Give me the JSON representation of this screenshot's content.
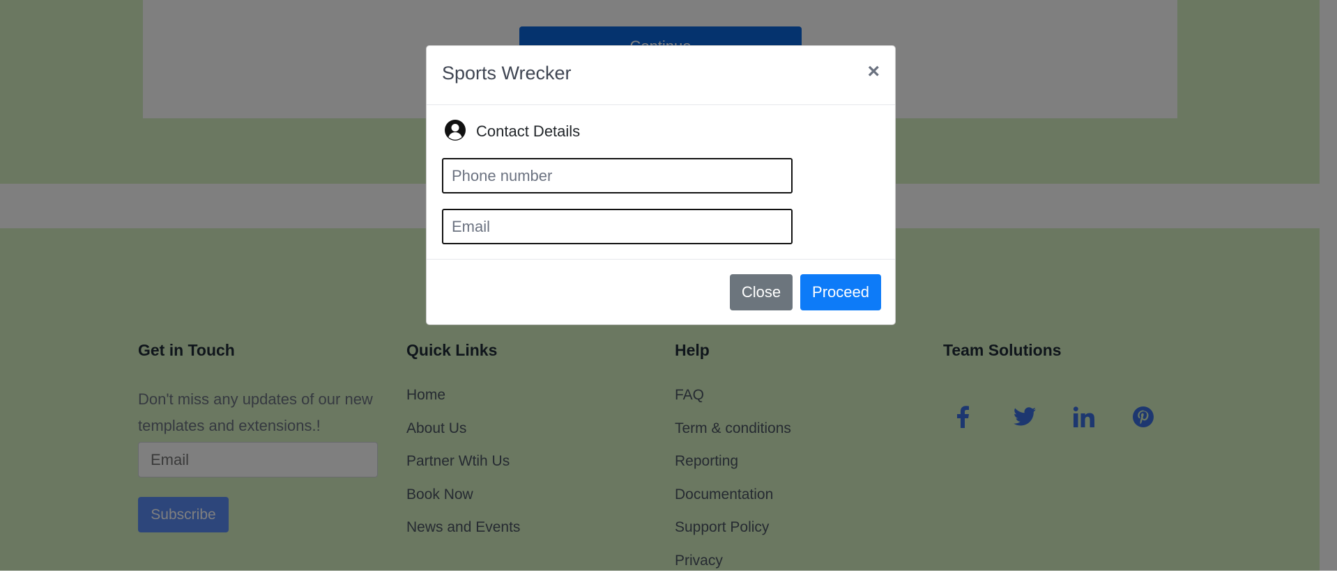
{
  "background": {
    "continue_button_label": "Continue"
  },
  "footer": {
    "get_in_touch": {
      "heading": "Get in Touch",
      "description": "Don't miss any updates of our new templates and extensions.!",
      "email_placeholder": "Email",
      "subscribe_label": "Subscribe"
    },
    "quick_links": {
      "heading": "Quick Links",
      "items": [
        "Home",
        "About Us",
        "Partner Wtih Us",
        "Book Now",
        "News and Events"
      ]
    },
    "help": {
      "heading": "Help",
      "items": [
        "FAQ",
        "Term & conditions",
        "Reporting",
        "Documentation",
        "Support Policy",
        "Privacy"
      ]
    },
    "team_solutions": {
      "heading": "Team Solutions",
      "social_icons": [
        "facebook-icon",
        "twitter-icon",
        "linkedin-icon",
        "pinterest-icon"
      ]
    }
  },
  "modal": {
    "title": "Sports Wrecker",
    "close_symbol": "×",
    "section_label": "Contact Details",
    "phone_placeholder": "Phone number",
    "email_placeholder": "Email",
    "close_label": "Close",
    "proceed_label": "Proceed"
  },
  "colors": {
    "page_green": "#d7f0c3",
    "primary_blue": "#0d7bf8",
    "secondary_gray": "#6c757d",
    "social_blue": "#3b6fe0"
  }
}
